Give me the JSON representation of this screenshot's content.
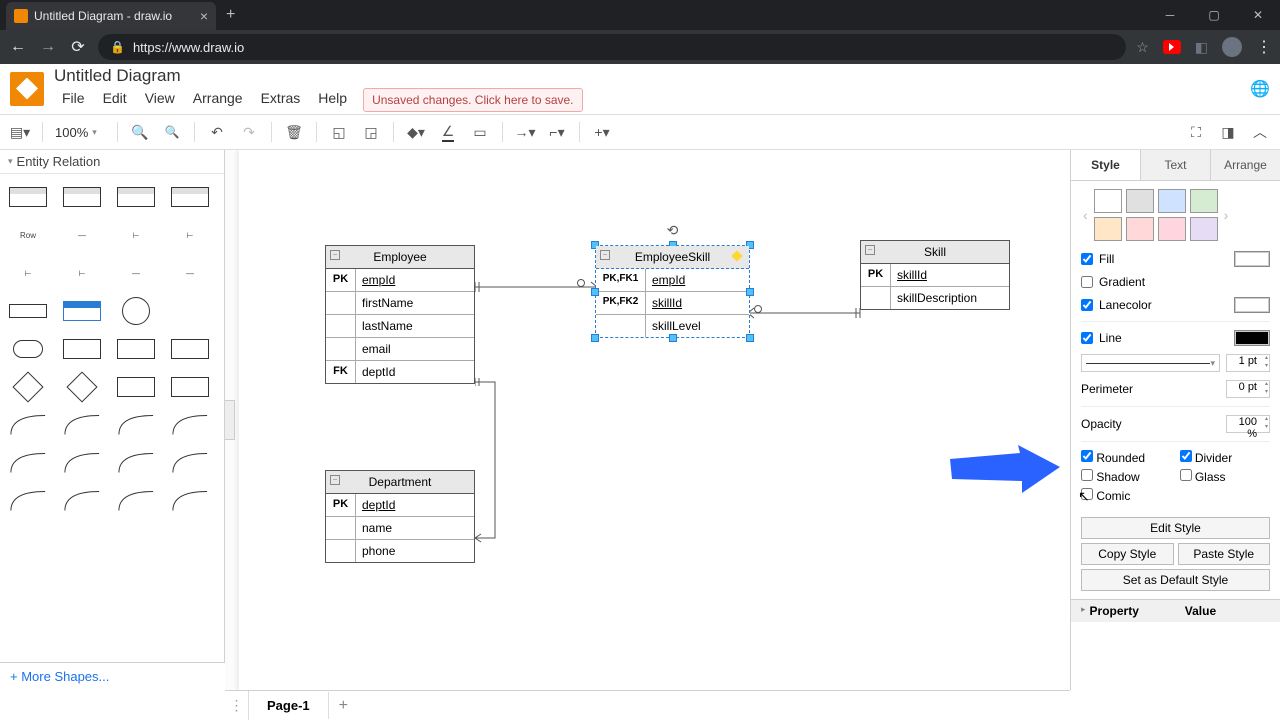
{
  "browser": {
    "tab_title": "Untitled Diagram - draw.io",
    "url": "https://www.draw.io"
  },
  "doc": {
    "title": "Untitled Diagram",
    "unsaved_msg": "Unsaved changes. Click here to save."
  },
  "menu": {
    "file": "File",
    "edit": "Edit",
    "view": "View",
    "arrange": "Arrange",
    "extras": "Extras",
    "help": "Help"
  },
  "toolbar": {
    "zoom": "100%"
  },
  "palette": {
    "title": "Entity Relation",
    "row_label": "Row",
    "more": "More Shapes..."
  },
  "tables": {
    "employee": {
      "title": "Employee",
      "rows": [
        {
          "key": "PK",
          "field": "empId",
          "u": true
        },
        {
          "key": "",
          "field": "firstName"
        },
        {
          "key": "",
          "field": "lastName"
        },
        {
          "key": "",
          "field": "email"
        },
        {
          "key": "FK",
          "field": "deptId"
        }
      ]
    },
    "empskill": {
      "title": "EmployeeSkill",
      "rows": [
        {
          "key": "PK,FK1",
          "field": "empId",
          "u": true
        },
        {
          "key": "PK,FK2",
          "field": "skillId",
          "u": true
        },
        {
          "key": "",
          "field": "skillLevel"
        }
      ]
    },
    "skill": {
      "title": "Skill",
      "rows": [
        {
          "key": "PK",
          "field": "skillId",
          "u": true
        },
        {
          "key": "",
          "field": "skillDescription"
        }
      ]
    },
    "department": {
      "title": "Department",
      "rows": [
        {
          "key": "PK",
          "field": "deptId",
          "u": true
        },
        {
          "key": "",
          "field": "name"
        },
        {
          "key": "",
          "field": "phone"
        }
      ]
    }
  },
  "rp": {
    "tabs": {
      "style": "Style",
      "text": "Text",
      "arrange": "Arrange"
    },
    "swatches": [
      "#ffffff",
      "#e0e0e0",
      "#cfe2ff",
      "#d6ecd2",
      "#ffe6c7",
      "#ffd9d9",
      "#ffd6e0",
      "#e6dcf5"
    ],
    "fill": "Fill",
    "gradient": "Gradient",
    "lanecolor": "Lanecolor",
    "line": "Line",
    "line_width": "1 pt",
    "perimeter": "Perimeter",
    "perimeter_val": "0 pt",
    "opacity": "Opacity",
    "opacity_val": "100 %",
    "rounded": "Rounded",
    "divider": "Divider",
    "shadow": "Shadow",
    "glass": "Glass",
    "comic": "Comic",
    "edit_style": "Edit Style",
    "copy_style": "Copy Style",
    "paste_style": "Paste Style",
    "default_style": "Set as Default Style",
    "property": "Property",
    "value": "Value"
  },
  "footer": {
    "page": "Page-1"
  }
}
